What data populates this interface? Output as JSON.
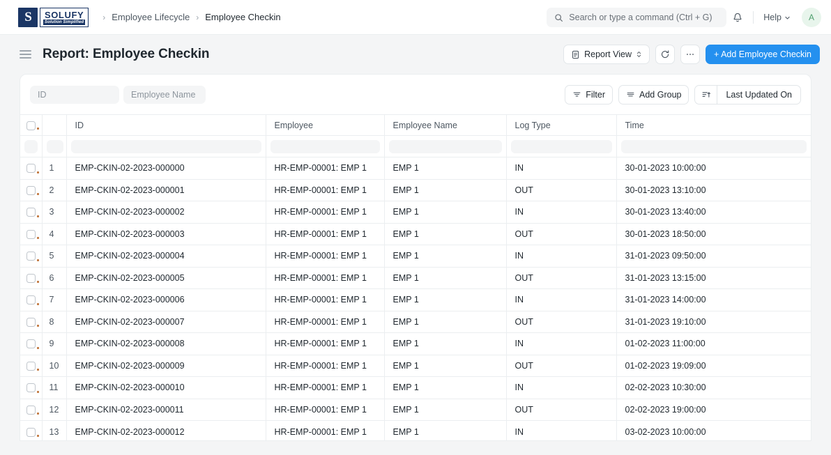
{
  "navbar": {
    "logo": {
      "mark": "S",
      "name": "SOLUFY",
      "tagline": "Solution Simplified"
    },
    "breadcrumb": [
      {
        "label": "Employee Lifecycle"
      },
      {
        "label": "Employee Checkin"
      }
    ],
    "search": {
      "placeholder": "Search or type a command (Ctrl + G)",
      "value": ""
    },
    "help_label": "Help",
    "avatar_initial": "A",
    "avatar_bg": "#e8f5ec",
    "avatar_color": "#4e9f6d"
  },
  "page": {
    "title": "Report: Employee Checkin",
    "report_view_label": "Report View",
    "add_button_label": "+ Add Employee Checkin",
    "primary_color": "#2490ef"
  },
  "filters": {
    "id": {
      "placeholder": "ID",
      "value": ""
    },
    "employee_name": {
      "placeholder": "Employee Name",
      "value": ""
    },
    "filter_label": "Filter",
    "add_group_label": "Add Group",
    "sort_label": "Last Updated On"
  },
  "table": {
    "columns": [
      "ID",
      "Employee",
      "Employee Name",
      "Log Type",
      "Time"
    ],
    "rows": [
      {
        "idx": "1",
        "id": "EMP-CKIN-02-2023-000000",
        "employee": "HR-EMP-00001: EMP 1",
        "employee_name": "EMP 1",
        "log_type": "IN",
        "time": "30-01-2023 10:00:00"
      },
      {
        "idx": "2",
        "id": "EMP-CKIN-02-2023-000001",
        "employee": "HR-EMP-00001: EMP 1",
        "employee_name": "EMP 1",
        "log_type": "OUT",
        "time": "30-01-2023 13:10:00"
      },
      {
        "idx": "3",
        "id": "EMP-CKIN-02-2023-000002",
        "employee": "HR-EMP-00001: EMP 1",
        "employee_name": "EMP 1",
        "log_type": "IN",
        "time": "30-01-2023 13:40:00"
      },
      {
        "idx": "4",
        "id": "EMP-CKIN-02-2023-000003",
        "employee": "HR-EMP-00001: EMP 1",
        "employee_name": "EMP 1",
        "log_type": "OUT",
        "time": "30-01-2023 18:50:00"
      },
      {
        "idx": "5",
        "id": "EMP-CKIN-02-2023-000004",
        "employee": "HR-EMP-00001: EMP 1",
        "employee_name": "EMP 1",
        "log_type": "IN",
        "time": "31-01-2023 09:50:00"
      },
      {
        "idx": "6",
        "id": "EMP-CKIN-02-2023-000005",
        "employee": "HR-EMP-00001: EMP 1",
        "employee_name": "EMP 1",
        "log_type": "OUT",
        "time": "31-01-2023 13:15:00"
      },
      {
        "idx": "7",
        "id": "EMP-CKIN-02-2023-000006",
        "employee": "HR-EMP-00001: EMP 1",
        "employee_name": "EMP 1",
        "log_type": "IN",
        "time": "31-01-2023 14:00:00"
      },
      {
        "idx": "8",
        "id": "EMP-CKIN-02-2023-000007",
        "employee": "HR-EMP-00001: EMP 1",
        "employee_name": "EMP 1",
        "log_type": "OUT",
        "time": "31-01-2023 19:10:00"
      },
      {
        "idx": "9",
        "id": "EMP-CKIN-02-2023-000008",
        "employee": "HR-EMP-00001: EMP 1",
        "employee_name": "EMP 1",
        "log_type": "IN",
        "time": "01-02-2023 11:00:00"
      },
      {
        "idx": "10",
        "id": "EMP-CKIN-02-2023-000009",
        "employee": "HR-EMP-00001: EMP 1",
        "employee_name": "EMP 1",
        "log_type": "OUT",
        "time": "01-02-2023 19:09:00"
      },
      {
        "idx": "11",
        "id": "EMP-CKIN-02-2023-000010",
        "employee": "HR-EMP-00001: EMP 1",
        "employee_name": "EMP 1",
        "log_type": "IN",
        "time": "02-02-2023 10:30:00"
      },
      {
        "idx": "12",
        "id": "EMP-CKIN-02-2023-000011",
        "employee": "HR-EMP-00001: EMP 1",
        "employee_name": "EMP 1",
        "log_type": "OUT",
        "time": "02-02-2023 19:00:00"
      },
      {
        "idx": "13",
        "id": "EMP-CKIN-02-2023-000012",
        "employee": "HR-EMP-00001: EMP 1",
        "employee_name": "EMP 1",
        "log_type": "IN",
        "time": "03-02-2023 10:00:00"
      }
    ]
  }
}
